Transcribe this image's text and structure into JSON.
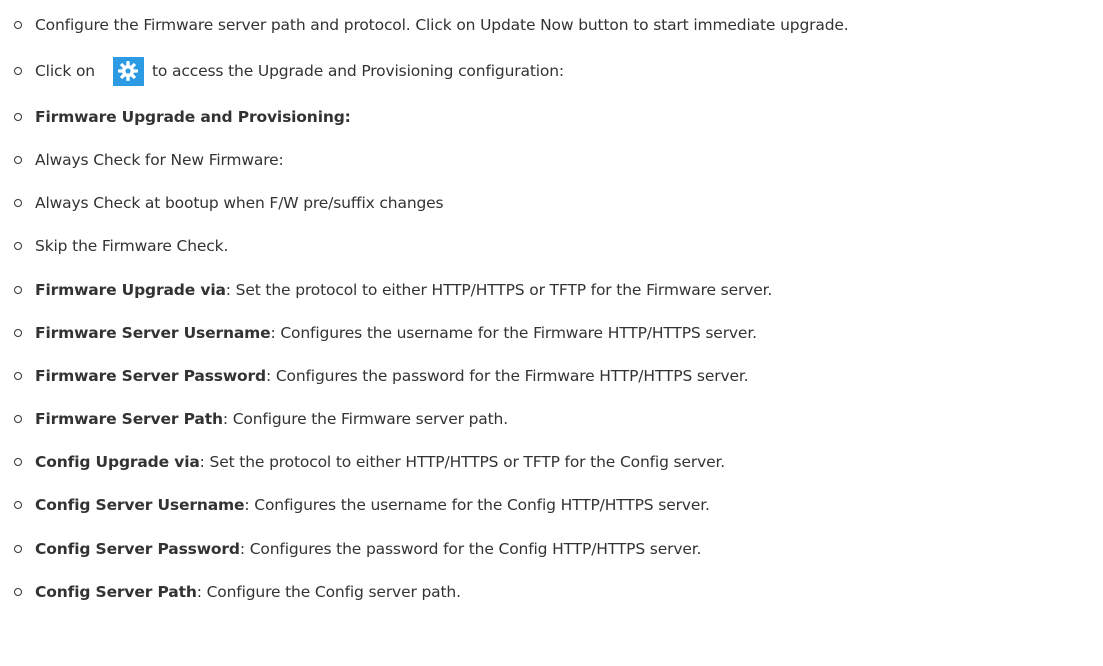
{
  "items": [
    {
      "text": "Configure the Firmware server path and protocol. Click on Update Now button to start immediate upgrade."
    },
    {
      "prefix": "Click on",
      "suffix": "to access the Upgrade and Provisioning configuration:",
      "icon": "gear-icon",
      "icon_bg": "#2d9be3"
    },
    {
      "bold": "Firmware Upgrade and Provisioning:"
    },
    {
      "text": "Always Check for New Firmware:"
    },
    {
      "text": "Always Check at bootup when F/W pre/suffix changes"
    },
    {
      "text": "Skip the Firmware Check."
    },
    {
      "bold": "Firmware Upgrade via",
      "text": ": Set the protocol to either HTTP/HTTPS or TFTP for the Firmware server."
    },
    {
      "bold": "Firmware Server Username",
      "text": ": Configures the username for the Firmware HTTP/HTTPS server."
    },
    {
      "bold": "Firmware Server Password",
      "text": ": Configures the password for the Firmware HTTP/HTTPS server."
    },
    {
      "bold": "Firmware Server Path",
      "text": ": Configure the Firmware server path."
    },
    {
      "bold": "Config Upgrade via",
      "text": ": Set the protocol to either HTTP/HTTPS or TFTP for the Config server."
    },
    {
      "bold": "Config Server Username",
      "text": ": Configures the username for the Config HTTP/HTTPS server."
    },
    {
      "bold": "Config Server Password",
      "text": ": Configures the password for the Config HTTP/HTTPS server."
    },
    {
      "bold": "Config Server Path",
      "text": ": Configure the Config server path."
    }
  ]
}
